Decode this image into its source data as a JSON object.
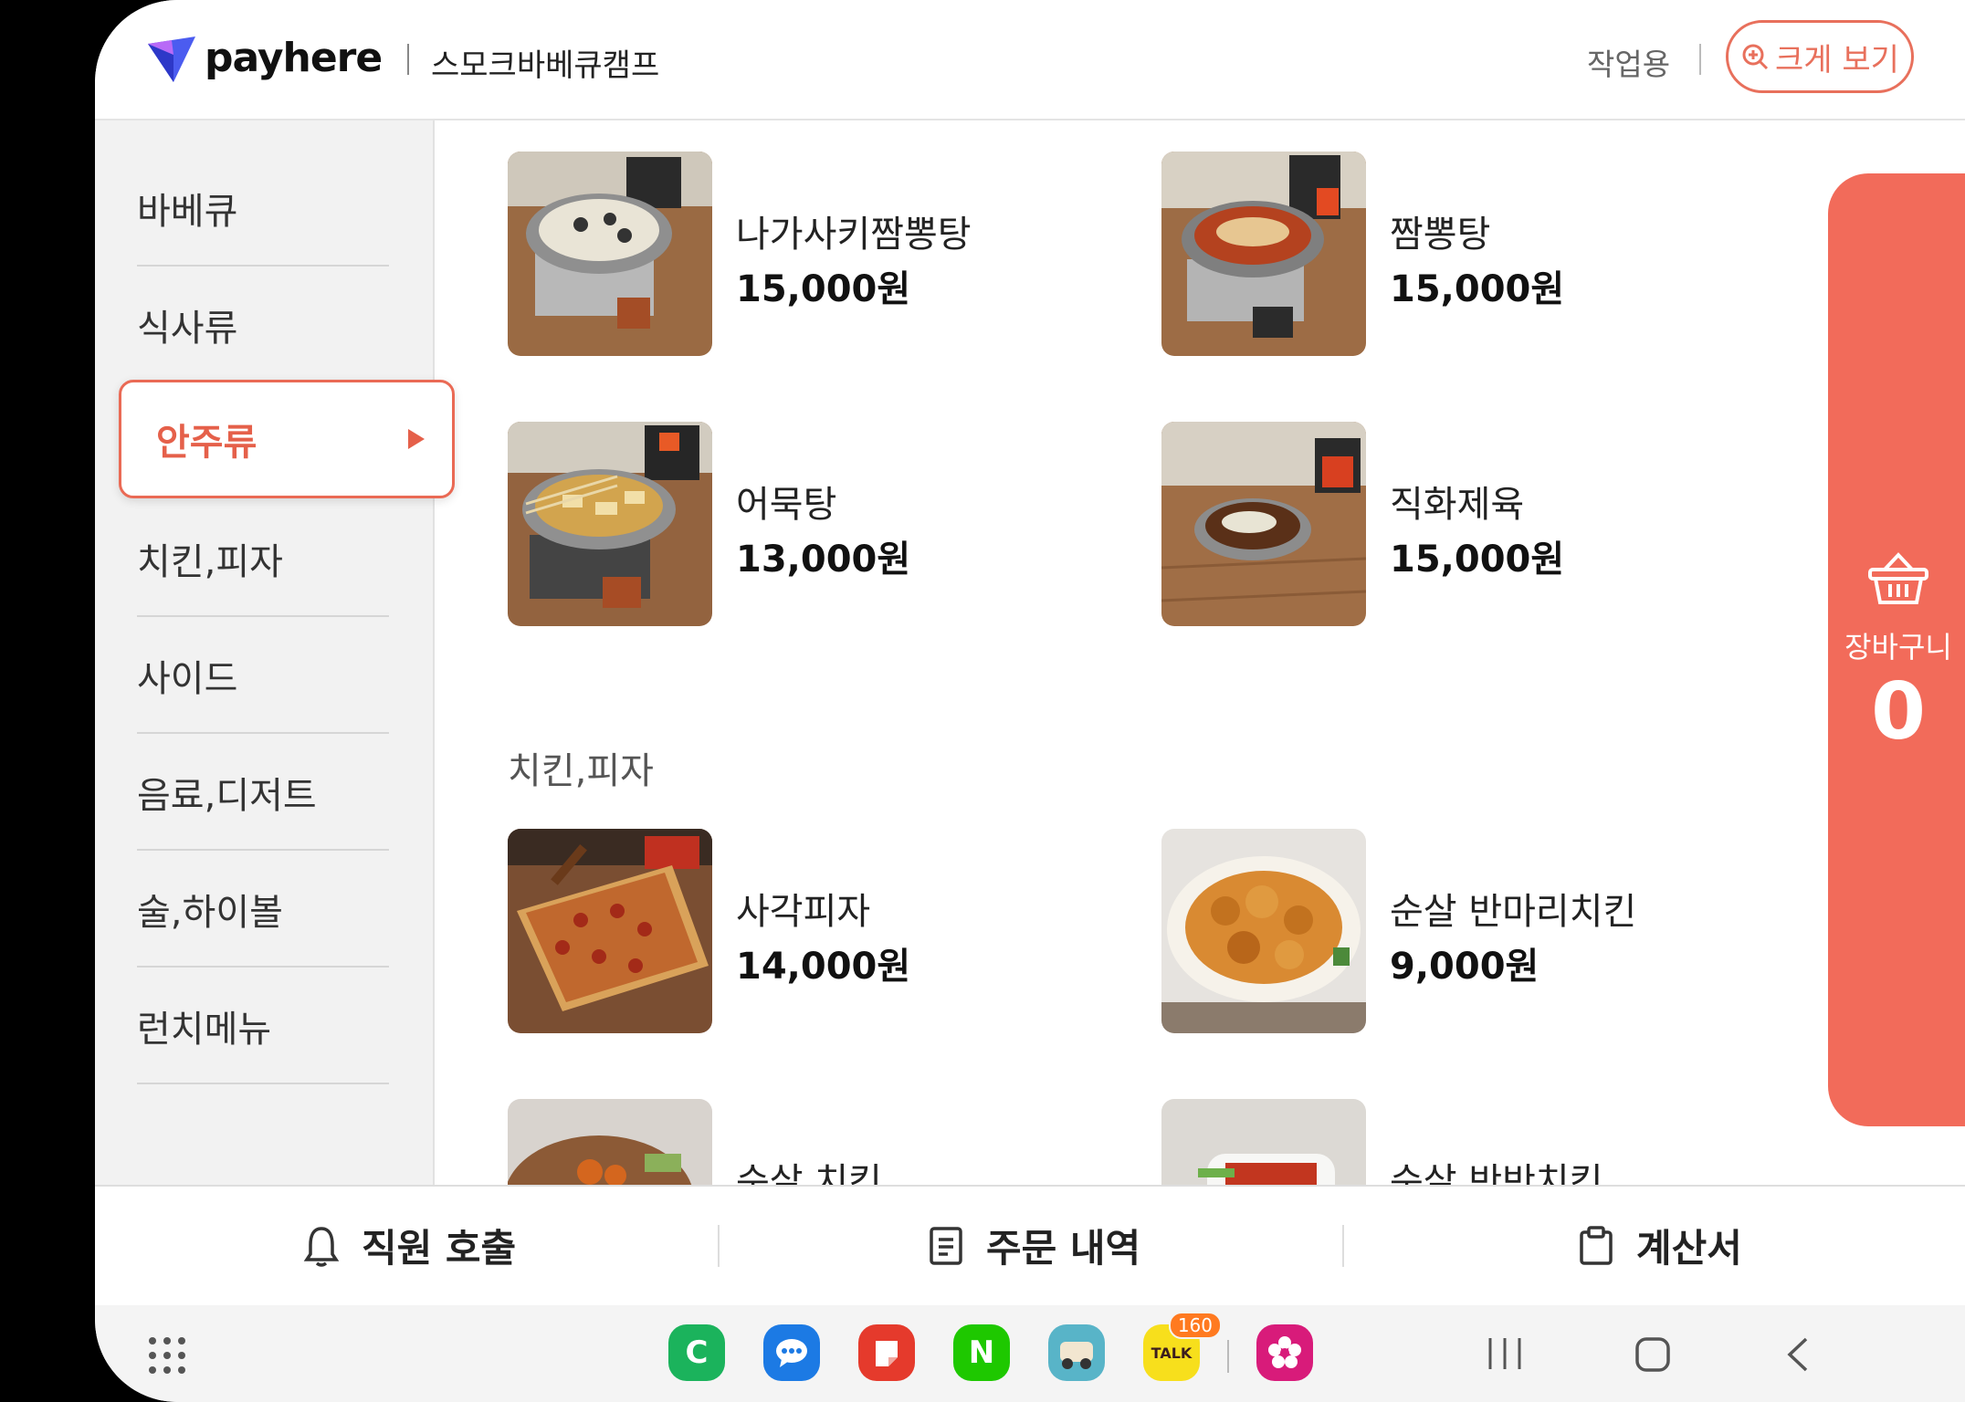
{
  "header": {
    "brand": "payhere",
    "store_name": "스모크바베큐캠프",
    "work_label": "작업용",
    "zoom_label": "크게 보기"
  },
  "sidebar": {
    "items": [
      {
        "label": "바베큐"
      },
      {
        "label": "식사류"
      },
      {
        "label": "안주류",
        "active": true
      },
      {
        "label": "치킨,피자"
      },
      {
        "label": "사이드"
      },
      {
        "label": "음료,디저트"
      },
      {
        "label": "술,하이볼"
      },
      {
        "label": "런치메뉴"
      }
    ]
  },
  "menu": {
    "items": [
      {
        "name": "나가사키짬뽕탕",
        "price": "15,000원"
      },
      {
        "name": "짬뽕탕",
        "price": "15,000원"
      },
      {
        "name": "어묵탕",
        "price": "13,000원"
      },
      {
        "name": "직화제육",
        "price": "15,000원"
      }
    ],
    "section_title": "치킨,피자",
    "section_items": [
      {
        "name": "사각피자",
        "price": "14,000원"
      },
      {
        "name": "순살 반마리치킨",
        "price": "9,000원"
      },
      {
        "name": "순살 치킨",
        "price": ""
      },
      {
        "name": "순살 반반치킨",
        "price": ""
      }
    ]
  },
  "cart": {
    "label": "장바구니",
    "count": "0",
    "color": "#f26b5a"
  },
  "actions": {
    "call_staff": "직원 호출",
    "order_history": "주문 내역",
    "bill": "계산서"
  },
  "system_nav": {
    "apps": [
      {
        "name": "camera-app-icon",
        "glyph": "C",
        "color": "#1bb35c"
      },
      {
        "name": "messages-app-icon",
        "glyph": "…",
        "color": "#1c7ae4"
      },
      {
        "name": "notes-app-icon",
        "glyph": "",
        "color": "#e53a2c"
      },
      {
        "name": "naver-app-icon",
        "glyph": "N",
        "color": "#1ec800"
      },
      {
        "name": "delivery-app-icon",
        "glyph": "",
        "color": "#58b4c8"
      },
      {
        "name": "kakaotalk-app-icon",
        "glyph": "TALK",
        "color": "#f7df1c",
        "badge": "160"
      },
      {
        "name": "gallery-app-icon",
        "glyph": "✿",
        "color": "#d81b7a"
      }
    ]
  }
}
